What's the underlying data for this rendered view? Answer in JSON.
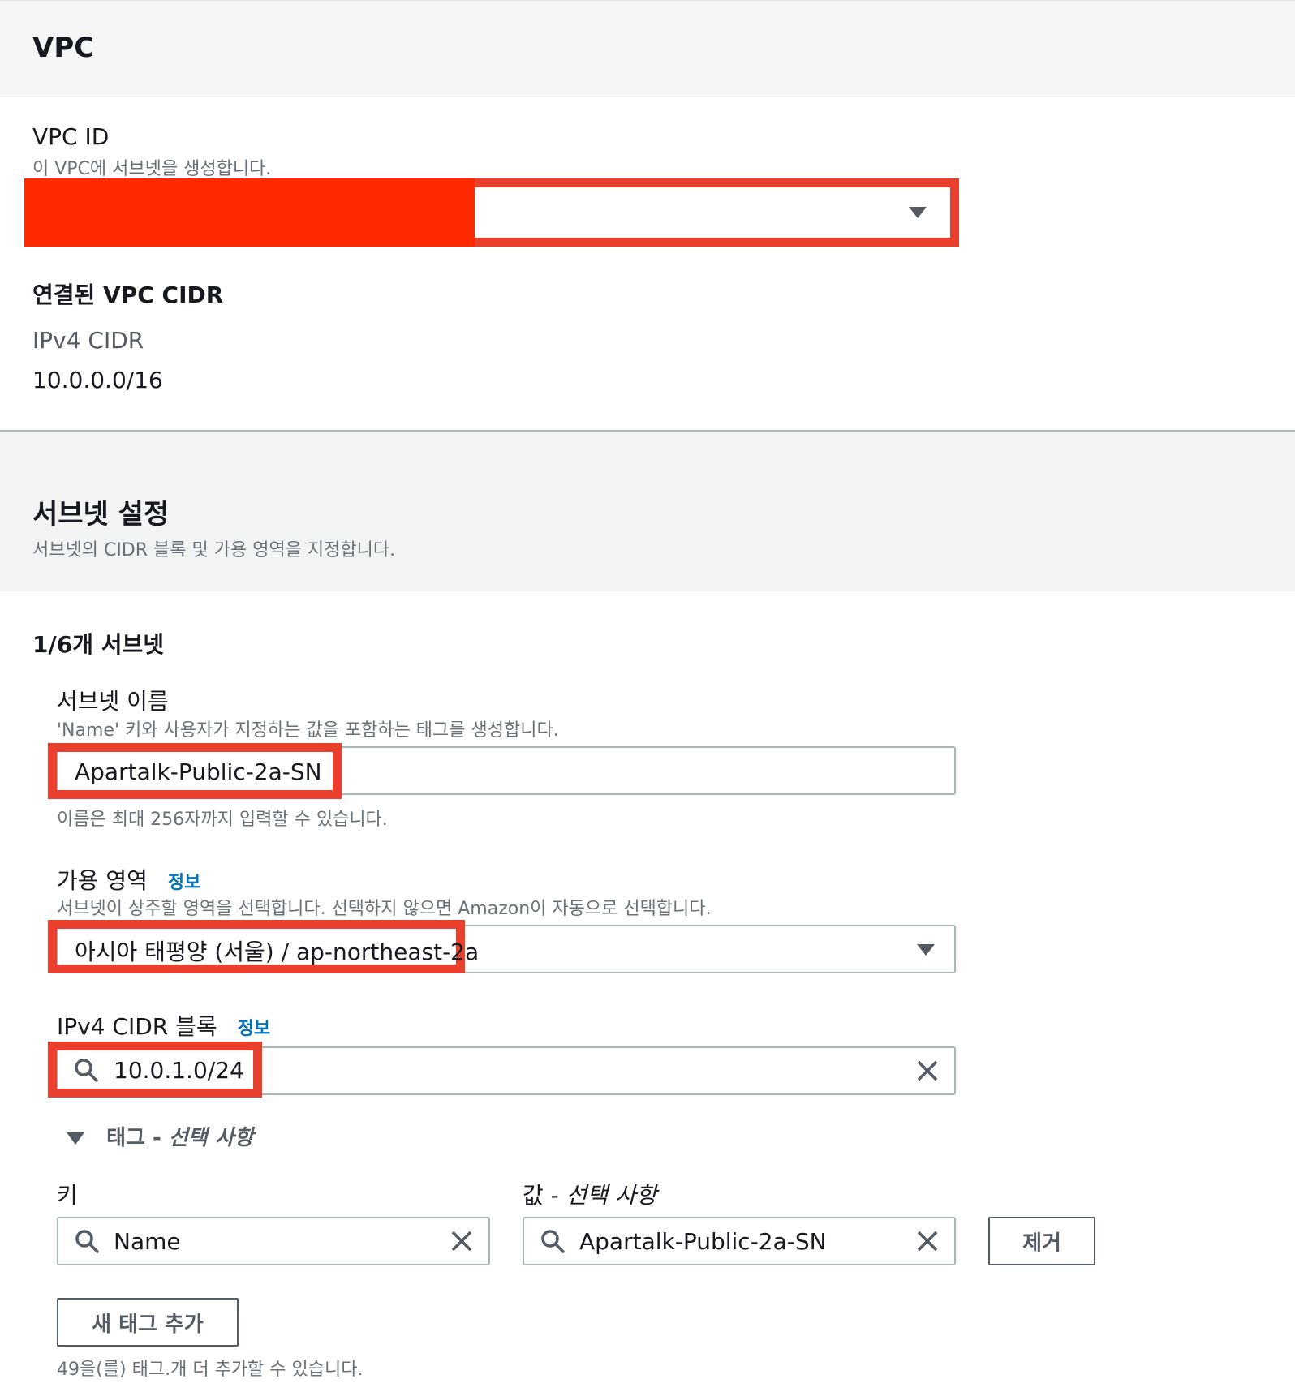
{
  "vpc_section": {
    "title": "VPC",
    "vpc_id_label": "VPC ID",
    "vpc_id_desc": "이 VPC에 서브넷을 생성합니다.",
    "vpc_id_value": ""
  },
  "cidr_section": {
    "title": "연결된 VPC CIDR",
    "ipv4_label": "IPv4 CIDR",
    "ipv4_value": "10.0.0.0/16"
  },
  "subnet_settings": {
    "title": "서브넷 설정",
    "desc": "서브넷의 CIDR 블록 및 가용 영역을 지정합니다."
  },
  "subnet": {
    "count_title": "1/6개 서브넷",
    "name_label": "서브넷 이름",
    "name_desc": "'Name' 키와 사용자가 지정하는 값을 포함하는 태그를 생성합니다.",
    "name_value": "Apartalk-Public-2a-SN",
    "name_hint": "이름은 최대 256자까지 입력할 수 있습니다.",
    "az_label": "가용 영역",
    "az_info": "정보",
    "az_desc": "서브넷이 상주할 영역을 선택합니다. 선택하지 않으면 Amazon이 자동으로 선택합니다.",
    "az_value": "아시아 태평양 (서울) / ap-northeast-2a",
    "cidr_label": "IPv4 CIDR 블록",
    "cidr_info": "정보",
    "cidr_value": "10.0.1.0/24"
  },
  "tags": {
    "toggle_label_plain": "태그 - ",
    "toggle_label_italic": "선택 사항",
    "key_label": "키",
    "value_label_plain": "값 - ",
    "value_label_italic": "선택 사항",
    "key_value": "Name",
    "value_value": "Apartalk-Public-2a-SN",
    "remove_button": "제거",
    "add_button": "새 태그 추가",
    "remaining_hint": "49을(를) 태그.개 더 추가할 수 있습니다."
  },
  "colors": {
    "redaction": "#ff2a00",
    "highlight_box": "#e8402c",
    "link": "#0073bb",
    "panel_header_bg": "#f5f6f6"
  },
  "icons": [
    "caret-down-icon",
    "search-icon",
    "close-icon",
    "triangle-down-icon"
  ]
}
